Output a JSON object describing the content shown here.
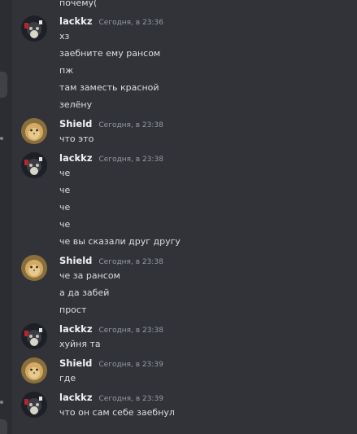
{
  "messages": [
    {
      "type": "continued",
      "text": "почему("
    },
    {
      "type": "group",
      "author": "lackkz",
      "timestamp": "Сегодня, в 23:36",
      "avatar_icon": "dark-character-avatar",
      "lines": [
        "хз",
        "заебните ему рансом",
        "пж",
        "там заместь красной",
        "зелёну"
      ]
    },
    {
      "type": "group",
      "author": "Shield",
      "timestamp": "Сегодня, в 23:38",
      "avatar_icon": "cat-face-avatar",
      "lines": [
        "что это"
      ]
    },
    {
      "type": "group",
      "author": "lackkz",
      "timestamp": "Сегодня, в 23:38",
      "avatar_icon": "dark-character-avatar",
      "lines": [
        "че",
        "че",
        "че",
        "че",
        "че вы сказали друг другу"
      ]
    },
    {
      "type": "group",
      "author": "Shield",
      "timestamp": "Сегодня, в 23:38",
      "avatar_icon": "cat-face-avatar",
      "lines": [
        "че за рансом",
        "а да забей",
        "прост"
      ]
    },
    {
      "type": "group",
      "author": "lackkz",
      "timestamp": "Сегодня, в 23:38",
      "avatar_icon": "dark-character-avatar",
      "lines": [
        "хуйня та"
      ]
    },
    {
      "type": "group",
      "author": "Shield",
      "timestamp": "Сегодня, в 23:39",
      "avatar_icon": "cat-face-avatar",
      "lines": [
        "где"
      ]
    },
    {
      "type": "group",
      "author": "lackkz",
      "timestamp": "Сегодня, в 23:39",
      "avatar_icon": "dark-character-avatar",
      "lines": [
        "что он сам себе заебнул"
      ]
    }
  ],
  "colors": {
    "background": "#313338",
    "rail": "#2b2d31",
    "author": "#f2f3f5",
    "timestamp": "#949ba4",
    "text": "#dbdee1"
  }
}
